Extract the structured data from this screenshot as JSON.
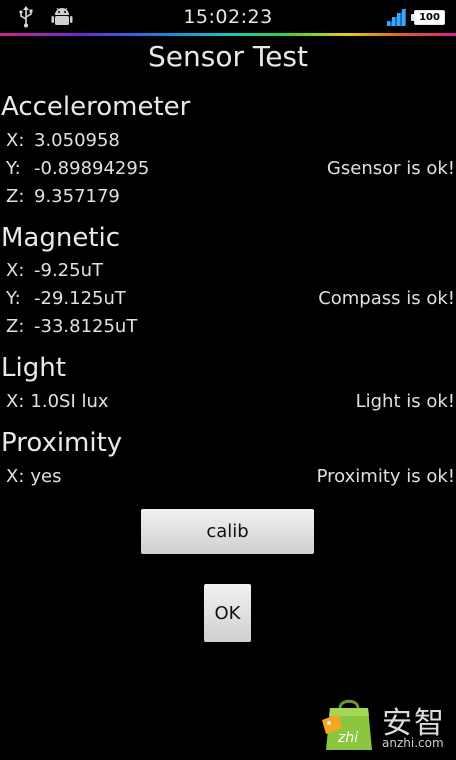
{
  "statusbar": {
    "time": "15:02:23",
    "battery_level": "100",
    "icons": [
      "usb-icon",
      "android-debug-icon",
      "signal-icon",
      "battery-icon"
    ]
  },
  "app": {
    "title": "Sensor Test"
  },
  "accelerometer": {
    "heading": "Accelerometer",
    "x_label": "X:",
    "x_value": "3.050958",
    "y_label": "Y:",
    "y_value": "-0.89894295",
    "z_label": "Z:",
    "z_value": "9.357179",
    "status": "Gsensor is ok!"
  },
  "magnetic": {
    "heading": "Magnetic",
    "x_label": "X:",
    "x_value": "-9.25uT",
    "y_label": "Y:",
    "y_value": "-29.125uT",
    "z_label": "Z:",
    "z_value": "-33.8125uT",
    "status": "Compass is ok!"
  },
  "light": {
    "heading": "Light",
    "x_label": "X:",
    "x_value": "1.0SI lux",
    "status": "Light is ok!"
  },
  "proximity": {
    "heading": "Proximity",
    "x_label": "X:",
    "x_value": "yes",
    "status": "Proximity is ok!"
  },
  "buttons": {
    "calib_label": "calib",
    "ok_label": "OK"
  },
  "watermark": {
    "cn_text": "安智",
    "en_text": "anzhi.com",
    "bag_text": "zhi",
    "colors": {
      "bag": "#8cc63f",
      "tag": "#f5a623"
    }
  }
}
